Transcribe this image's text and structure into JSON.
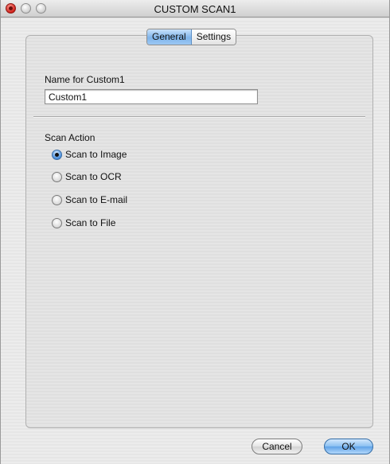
{
  "window": {
    "title": "CUSTOM SCAN1"
  },
  "tabs": [
    {
      "label": "General",
      "selected": true
    },
    {
      "label": "Settings",
      "selected": false
    }
  ],
  "general": {
    "name_label": "Name for Custom1",
    "name_value": "Custom1",
    "scan_action_label": "Scan Action",
    "options": [
      {
        "label": "Scan to Image",
        "checked": true
      },
      {
        "label": "Scan to OCR",
        "checked": false
      },
      {
        "label": "Scan to E-mail",
        "checked": false
      },
      {
        "label": "Scan to File",
        "checked": false
      }
    ]
  },
  "buttons": {
    "cancel": "Cancel",
    "ok": "OK"
  },
  "colors": {
    "accent": "#7fb4ea",
    "close": "#d0201a"
  }
}
